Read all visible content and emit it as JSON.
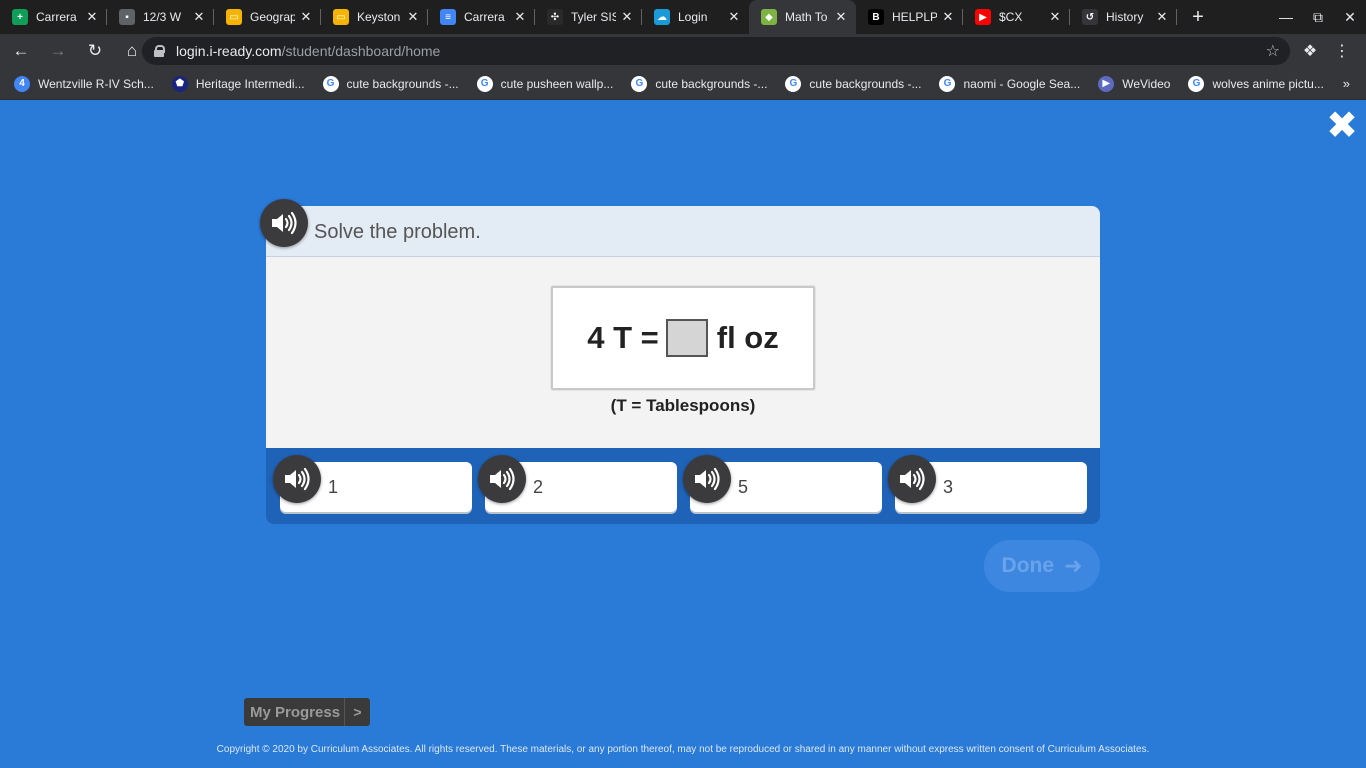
{
  "browser": {
    "tabs": [
      {
        "label": "Carrera",
        "icon": "sheets-icon",
        "color": "#0f9d58",
        "glyph": "+"
      },
      {
        "label": "12/3 W",
        "icon": "contact-icon",
        "color": "#5f6368",
        "glyph": "▪"
      },
      {
        "label": "Geograp",
        "icon": "slides-icon",
        "color": "#f4b400",
        "glyph": "▭"
      },
      {
        "label": "Keyston",
        "icon": "slides-icon",
        "color": "#f4b400",
        "glyph": "▭"
      },
      {
        "label": "Carrera",
        "icon": "docs-icon",
        "color": "#4285f4",
        "glyph": "≡"
      },
      {
        "label": "Tyler SIS",
        "icon": "tyler-icon",
        "color": "#2a2a2a",
        "glyph": "✣"
      },
      {
        "label": "Login",
        "icon": "cloud-icon",
        "color": "#1a9bd7",
        "glyph": "☁"
      },
      {
        "label": "Math To",
        "icon": "iready-cube-icon",
        "color": "#7cb342",
        "glyph": "◆"
      },
      {
        "label": "HELPLP",
        "icon": "brainly-icon",
        "color": "#000000",
        "glyph": "B"
      },
      {
        "label": "$CX",
        "icon": "youtube-icon",
        "color": "#ff0000",
        "glyph": "▶"
      },
      {
        "label": "History",
        "icon": "history-icon",
        "color": "#35363a",
        "glyph": "↺"
      }
    ],
    "active_tab_index": 7,
    "url_host": "login.i-ready.com",
    "url_path": "/student/dashboard/home",
    "bookmarks": [
      {
        "label": "Wentzville R-IV Sch...",
        "icon": "calendar-icon",
        "color": "#4285f4",
        "glyph": "4"
      },
      {
        "label": "Heritage Intermedi...",
        "icon": "school-icon",
        "color": "#1a237e",
        "glyph": "⬟"
      },
      {
        "label": "cute backgrounds -...",
        "icon": "google-icon",
        "color": "#ffffff",
        "glyph": "G"
      },
      {
        "label": "cute pusheen wallp...",
        "icon": "google-icon",
        "color": "#ffffff",
        "glyph": "G"
      },
      {
        "label": "cute backgrounds -...",
        "icon": "google-icon",
        "color": "#ffffff",
        "glyph": "G"
      },
      {
        "label": "cute backgrounds -...",
        "icon": "google-icon",
        "color": "#ffffff",
        "glyph": "G"
      },
      {
        "label": "naomi - Google Sea...",
        "icon": "google-icon",
        "color": "#ffffff",
        "glyph": "G"
      },
      {
        "label": "WeVideo",
        "icon": "wevideo-icon",
        "color": "#5c6bc0",
        "glyph": "▶"
      },
      {
        "label": "wolves anime pictu...",
        "icon": "google-icon",
        "color": "#ffffff",
        "glyph": "G"
      }
    ]
  },
  "lesson": {
    "prompt": "Solve the problem.",
    "equation_left": "4 T =",
    "equation_right": "fl oz",
    "note": "(T = Tablespoons)",
    "answers": [
      "1",
      "2",
      "5",
      "3"
    ],
    "done_label": "Done",
    "progress_label": "My Progress",
    "progress_chevron": ">"
  },
  "footer": {
    "copyright": "Copyright © 2020 by Curriculum Associates. All rights reserved. These materials, or any portion thereof, may not be reproduced or shared in any manner without express written consent of Curriculum Associates."
  },
  "colors": {
    "page_background": "#2a7ad8",
    "answer_tray": "#1f63b8",
    "speaker_button": "#3b3b3d",
    "done_button_disabled": "#3e87e0"
  }
}
